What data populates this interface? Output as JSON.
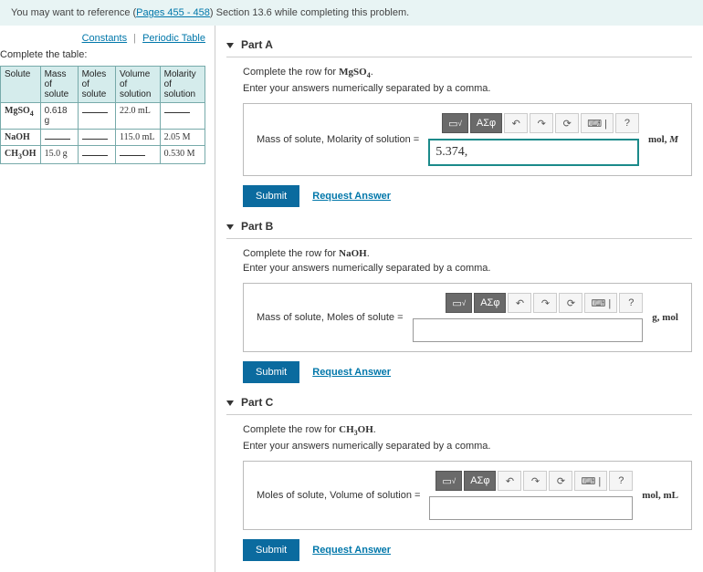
{
  "topbar": {
    "prefix": "You may want to reference (",
    "link": "Pages 455 - 458",
    "suffix": ") Section 13.6 while completing this problem."
  },
  "links": {
    "constants": "Constants",
    "periodic": "Periodic Table"
  },
  "left": {
    "instruction": "Complete the table:",
    "headers": {
      "c0": "Solute",
      "c1": "Mass of solute",
      "c2": "Moles of solute",
      "c3": "Volume of solution",
      "c4": "Molarity of solution"
    },
    "rows": [
      {
        "solute": "MgSO₄",
        "mass": "0.618 g",
        "moles": "",
        "volume": "22.0 mL",
        "molarity": ""
      },
      {
        "solute": "NaOH",
        "mass": "",
        "moles": "",
        "volume": "115.0 mL",
        "molarity": "2.05 M"
      },
      {
        "solute": "CH₃OH",
        "mass": "15.0 g",
        "moles": "",
        "volume": "",
        "molarity": "0.530 M"
      }
    ]
  },
  "toolbar": {
    "b1": "√x",
    "b2": "ΑΣφ",
    "undo": "↶",
    "redo": "↷",
    "reset": "⟳",
    "kb": "⌨ |",
    "help": "?"
  },
  "partA": {
    "title": "Part A",
    "line1": "Complete the row for MgSO₄.",
    "line2": "Enter your answers numerically separated by a comma.",
    "label": "Mass of solute, Molarity of solution =",
    "value": "5.374,",
    "unit": "mol, M",
    "submit": "Submit",
    "request": "Request Answer"
  },
  "partB": {
    "title": "Part B",
    "line1": "Complete the row for NaOH.",
    "line2": "Enter your answers numerically separated by a comma.",
    "label": "Mass of solute, Moles of solute =",
    "value": "",
    "unit": "g, mol",
    "submit": "Submit",
    "request": "Request Answer"
  },
  "partC": {
    "title": "Part C",
    "line1": "Complete the row for CH₃OH.",
    "line2": "Enter your answers numerically separated by a comma.",
    "label": "Moles of solute, Volume of solution =",
    "value": "",
    "unit": "mol, mL",
    "submit": "Submit",
    "request": "Request Answer"
  }
}
